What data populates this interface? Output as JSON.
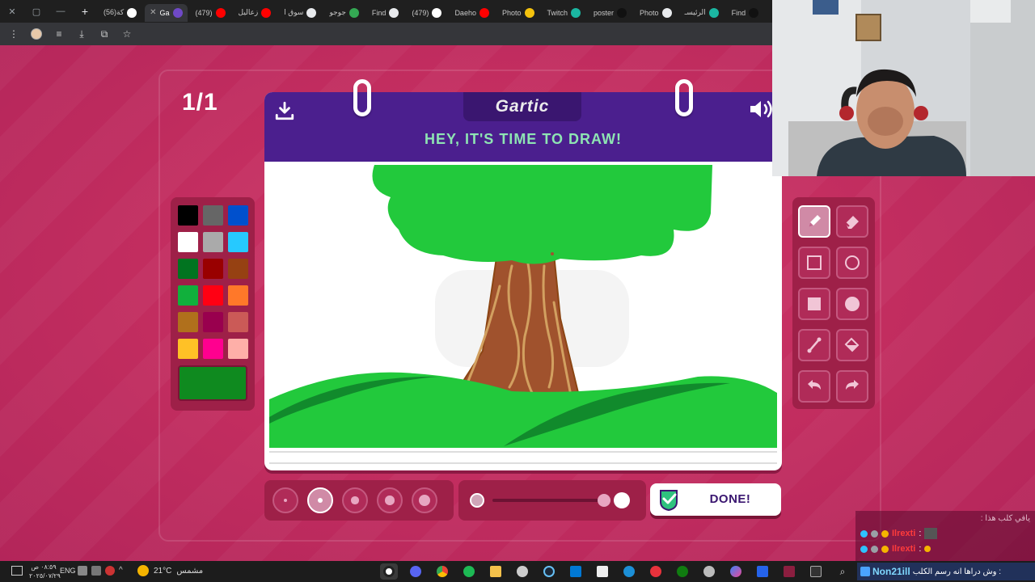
{
  "browser": {
    "window_controls": [
      "✕",
      "▢",
      "—"
    ],
    "new_tab": "+",
    "tabs": [
      {
        "label": "كة(56)",
        "color": "#ffffff",
        "active": false
      },
      {
        "label": "Ga",
        "color": "#6f49c7",
        "active": true
      },
      {
        "label": "(479)",
        "color": "#ff0000",
        "active": false
      },
      {
        "label": "زعاليل",
        "color": "#ff0000",
        "active": false
      },
      {
        "label": "سوق ا",
        "color": "#e8eaed",
        "active": false
      },
      {
        "label": "جوجو",
        "color": "#34a853",
        "active": false
      },
      {
        "label": "Find ",
        "color": "#e8eaed",
        "active": false
      },
      {
        "label": "(479)",
        "color": "#ffffff",
        "active": false
      },
      {
        "label": "Daeho",
        "color": "#ff0000",
        "active": false
      },
      {
        "label": "Photo",
        "color": "#f4c20d",
        "active": false
      },
      {
        "label": "Twitch",
        "color": "#1bb7a2",
        "active": false
      },
      {
        "label": "poster",
        "color": "#111111",
        "active": false
      },
      {
        "label": "Photo",
        "color": "#e8eaed",
        "active": false
      },
      {
        "label": "الرئيسـ",
        "color": "#1bb7a2",
        "active": false
      },
      {
        "label": "Find ",
        "color": "#111111",
        "active": false
      }
    ],
    "toolbar_icons": [
      "menu-icon",
      "profile-icon",
      "reading-list-icon",
      "download-icon",
      "extensions-icon",
      "bookmark-star-icon"
    ]
  },
  "game": {
    "round": "1/1",
    "logo": "Gartic",
    "prompt": "HEY, IT'S TIME TO DRAW!",
    "done_label": "DONE!",
    "palette": [
      "#000000",
      "#666666",
      "#0050cd",
      "#ffffff",
      "#aaaaaa",
      "#26c9ff",
      "#017420",
      "#990000",
      "#964112",
      "#11b03c",
      "#ff0013",
      "#ff7829",
      "#b0701c",
      "#99004e",
      "#cb5a57",
      "#ffc126",
      "#ff008f",
      "#feafa8"
    ],
    "selected_color": "#0f8a1f",
    "tools": [
      "pen",
      "eraser",
      "rectangle",
      "ellipse",
      "filled-rectangle",
      "filled-ellipse",
      "line",
      "fill-bucket",
      "undo",
      "redo"
    ],
    "active_tool": "pen",
    "brush_sizes": [
      1,
      2,
      3,
      4,
      5
    ],
    "active_brush_size": 2,
    "opacity_percent": 100
  },
  "stream": {
    "chat_title": "يافي كلب هذا :",
    "chat_lines": [
      {
        "user": "Ilrexti",
        "sep": ":"
      },
      {
        "user": "Ilrexti",
        "sep": ":"
      }
    ],
    "chat_message_user": "Non21ill",
    "chat_message_text": ": وش دراها انه رسم الكلب"
  },
  "taskbar": {
    "clock_time": "٠٨:٥٩ ص",
    "clock_date": "٢٠٢٥/٠٧/٢٩",
    "lang": "ENG",
    "weather_temp": "21°C",
    "weather_desc": "مشمس"
  }
}
